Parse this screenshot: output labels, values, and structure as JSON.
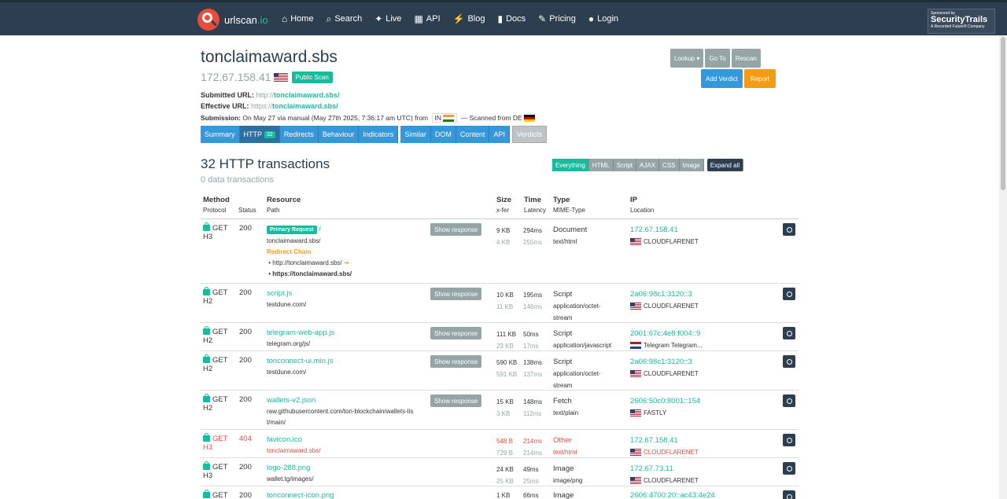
{
  "nav": {
    "brand_name": "urlscan",
    "brand_tld": ".io",
    "links": [
      {
        "icon": "⌂",
        "label": "Home"
      },
      {
        "icon": "⌕",
        "label": "Search"
      },
      {
        "icon": "✦",
        "label": "Live"
      },
      {
        "icon": "▦",
        "label": "API"
      },
      {
        "icon": "⚡",
        "label": "Blog"
      },
      {
        "icon": "▮",
        "label": "Docs"
      },
      {
        "icon": "✎",
        "label": "Pricing"
      },
      {
        "icon": "●",
        "label": "Login"
      }
    ],
    "sponsor_line1": "Sponsored by",
    "sponsor_name": "SecurityTrails",
    "sponsor_line3": "A Recorded Future® Company"
  },
  "header": {
    "domain": "tonclaimaward.sbs",
    "ip": "172.67.158.41",
    "badge": "Public Scan",
    "submitted_label": "Submitted URL:",
    "submitted_scheme": "http://",
    "submitted_host": "tonclaimaward.sbs",
    "submitted_path": "/",
    "effective_label": "Effective URL:",
    "effective_scheme": "https://",
    "effective_host": "tonclaimaward.sbs",
    "effective_path": "/",
    "submission_label": "Submission:",
    "submission_text": "On May 27 via manual (May 27th 2025, 7:36:17 am UTC) from",
    "submission_cc": "IN",
    "scanned_from": "— Scanned from",
    "scanned_cc": "DE"
  },
  "actions": {
    "lookup": "Lookup ▾",
    "goto": "Go To",
    "rescan": "Rescan",
    "add_verdict": "Add Verdict",
    "report": "Report"
  },
  "tabs": [
    {
      "label": "Summary"
    },
    {
      "label": "HTTP",
      "count": "32"
    },
    {
      "label": "Redirects"
    },
    {
      "label": "Behaviour"
    },
    {
      "label": "Indicators"
    },
    {
      "label": "Similar"
    },
    {
      "label": "DOM"
    },
    {
      "label": "Content"
    },
    {
      "label": "API"
    },
    {
      "label": "Verdicts"
    }
  ],
  "section": {
    "title": "32 HTTP transactions",
    "subtitle": "0 data transactions"
  },
  "filters": [
    "Everything",
    "HTML",
    "Script",
    "AJAX",
    "CSS",
    "Image",
    "Expand all"
  ],
  "table": {
    "headers": {
      "method": "Method",
      "protocol": "Protocol",
      "status": "Status",
      "resource": "Resource",
      "path": "Path",
      "size": "Size",
      "xfer": "x-fer",
      "time": "Time",
      "latency": "Latency",
      "type": "Type",
      "mime": "MIME-Type",
      "ip": "IP",
      "location": "Location"
    },
    "show_response": "Show response",
    "primary_request": "Primary Request",
    "redirect_chain": "Redirect Chain",
    "rows": [
      {
        "method": "GET",
        "proto": "H3",
        "status": "200",
        "resource": "/",
        "path": "tonclaimaward.sbs/",
        "size": "9 KB",
        "xfer": "4 KB",
        "time": "294ms",
        "latency": "255ms",
        "type": "Document",
        "mime": "text/html",
        "ip": "172.67.158.41",
        "loc": "CLOUDFLARENET",
        "chain1": "http://tonclaimaward.sbs/",
        "chain2": "https://tonclaimaward.sbs/"
      },
      {
        "method": "GET",
        "proto": "H2",
        "status": "200",
        "resource": "script.js",
        "path": "testdune.com/",
        "size": "10 KB",
        "xfer": "11 KB",
        "time": "195ms",
        "latency": "146ms",
        "type": "Script",
        "mime": "application/octet-",
        "mime2": "stream",
        "ip": "2a06:98c1:3120::3",
        "loc": "CLOUDFLARENET"
      },
      {
        "method": "GET",
        "proto": "H2",
        "status": "200",
        "resource": "telegram-web-app.js",
        "path": "telegram.org/js/",
        "size": "111 KB",
        "xfer": "23 KB",
        "time": "50ms",
        "latency": "17ms",
        "type": "Script",
        "mime": "application/javascript",
        "ip": "2001:67c:4e8:f004::9",
        "loc": "Telegram Telegram..."
      },
      {
        "method": "GET",
        "proto": "H2",
        "status": "200",
        "resource": "tonconnect-ui.min.js",
        "path": "testdune.com/",
        "size": "590 KB",
        "xfer": "591 KB",
        "time": "138ms",
        "latency": "137ms",
        "type": "Script",
        "mime": "application/octet-",
        "mime2": "stream",
        "ip": "2a06:98c1:3120::3",
        "loc": "CLOUDFLARENET"
      },
      {
        "method": "GET",
        "proto": "H2",
        "status": "200",
        "resource": "wallets-v2.json",
        "path": "raw.githubusercontent.com/ton-blockchain/wallets-lis",
        "path2": "t/main/",
        "size": "15 KB",
        "xfer": "3 KB",
        "time": "148ms",
        "latency": "112ms",
        "type": "Fetch",
        "mime": "text/plain",
        "ip": "2606:50c0:8001::154",
        "loc": "FASTLY"
      },
      {
        "method": "GET",
        "proto": "H3",
        "status": "404",
        "resource": "favicon.ico",
        "path": "tonclaimaward.sbs/",
        "size": "548 B",
        "xfer": "729 B",
        "time": "214ms",
        "latency": "214ms",
        "type": "Other",
        "mime": "text/html",
        "ip": "172.67.158.41",
        "loc": "CLOUDFLARENET"
      },
      {
        "method": "GET",
        "proto": "H3",
        "status": "200",
        "resource": "logo-288.png",
        "path": "wallet.tg/images/",
        "size": "24 KB",
        "xfer": "25 KB",
        "time": "49ms",
        "latency": "25ms",
        "type": "Image",
        "mime": "image/png",
        "ip": "172.67.73.11",
        "loc": "CLOUDFLARENET"
      },
      {
        "method": "GET",
        "proto": "",
        "status": "200",
        "resource": "tonconnect-icon.png",
        "path": "",
        "size": "1 KB",
        "xfer": "",
        "time": "66ms",
        "latency": "",
        "type": "Image",
        "mime": "",
        "ip": "2606:4700:20::ac43:4e24",
        "loc": ""
      }
    ]
  }
}
